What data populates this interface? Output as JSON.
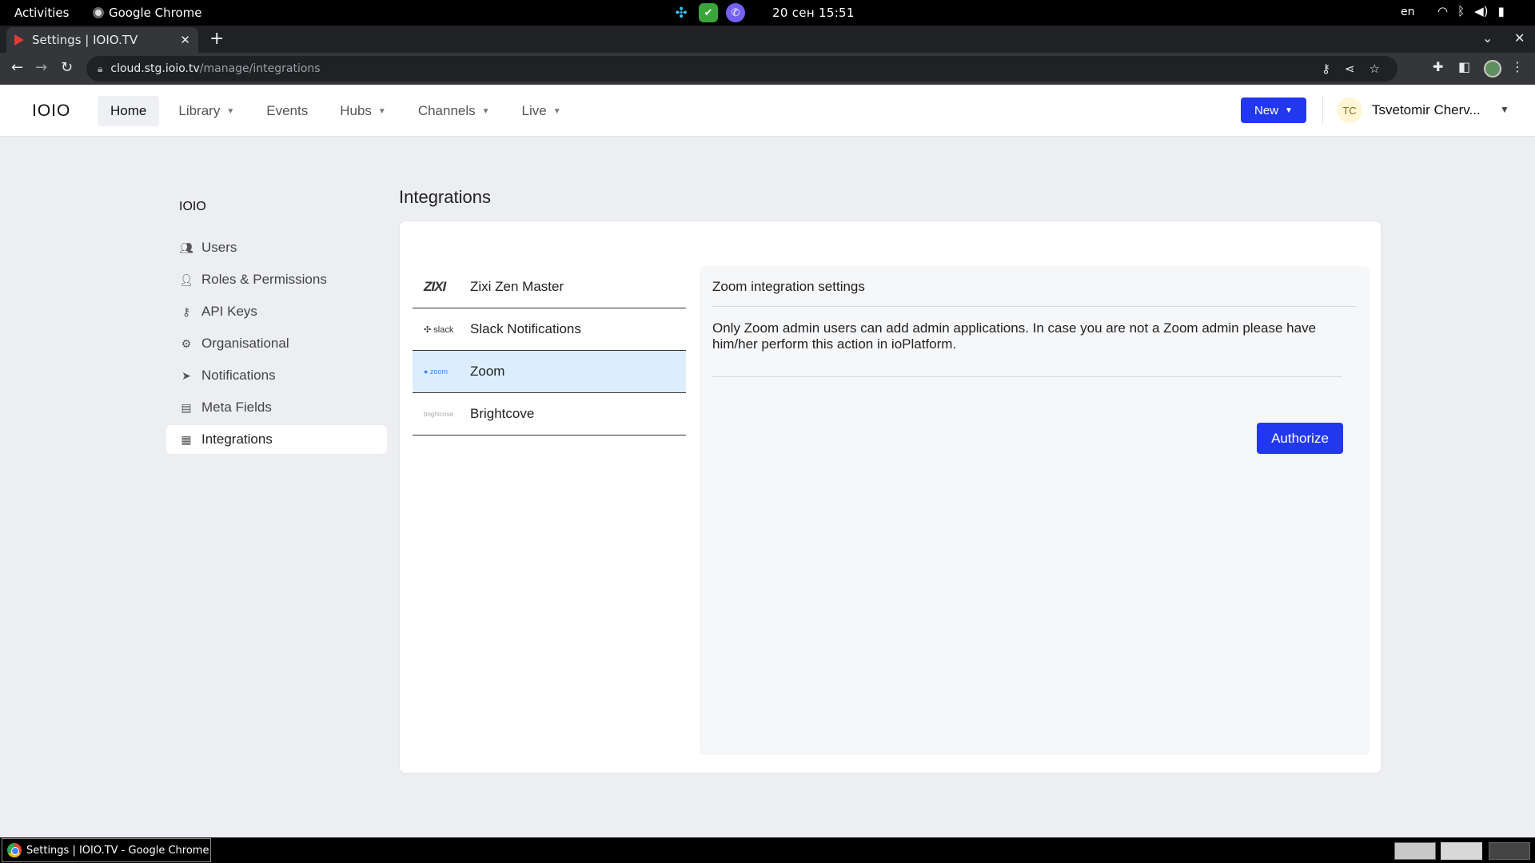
{
  "os": {
    "activities": "Activities",
    "app_name": "Google Chrome",
    "clock": "20 сен  15:51",
    "lang": "en"
  },
  "browser": {
    "tab_title": "Settings | IOIO.TV",
    "url_host": "cloud.stg.ioio.tv",
    "url_path": "/manage/integrations"
  },
  "header": {
    "logo": "IOIO",
    "nav": [
      {
        "label": "Home"
      },
      {
        "label": "Library"
      },
      {
        "label": "Events"
      },
      {
        "label": "Hubs"
      },
      {
        "label": "Channels"
      },
      {
        "label": "Live"
      }
    ],
    "new_label": "New",
    "user_initials": "TC",
    "user_name": "Tsvetomir Cherv..."
  },
  "sidebar": {
    "title": "IOIO",
    "items": [
      {
        "label": "Users",
        "icon": "users-icon"
      },
      {
        "label": "Roles & Permissions",
        "icon": "user-cog-icon"
      },
      {
        "label": "API Keys",
        "icon": "key-icon"
      },
      {
        "label": "Organisational",
        "icon": "gear-icon"
      },
      {
        "label": "Notifications",
        "icon": "paper-plane-icon"
      },
      {
        "label": "Meta Fields",
        "icon": "table-icon"
      },
      {
        "label": "Integrations",
        "icon": "grid-icon"
      }
    ]
  },
  "main": {
    "title": "Integrations",
    "integrations": [
      {
        "label": "Zixi Zen Master",
        "logo": "ZIXI"
      },
      {
        "label": "Slack Notifications",
        "logo": "✣ slack"
      },
      {
        "label": "Zoom",
        "logo": "● zoom"
      },
      {
        "label": "Brightcove",
        "logo": "brightcove"
      }
    ],
    "settings": {
      "heading": "Zoom integration settings",
      "description": "Only Zoom admin users can add admin applications. In case you are not a Zoom admin please have him/her perform this action in ioPlatform.",
      "authorize_label": "Authorize"
    }
  },
  "taskbar": {
    "window_title": "Settings | IOIO.TV - Google Chrome"
  },
  "colors": {
    "accent": "#2138ef",
    "selected_row": "#dceefc",
    "page_bg": "#eceef2"
  }
}
